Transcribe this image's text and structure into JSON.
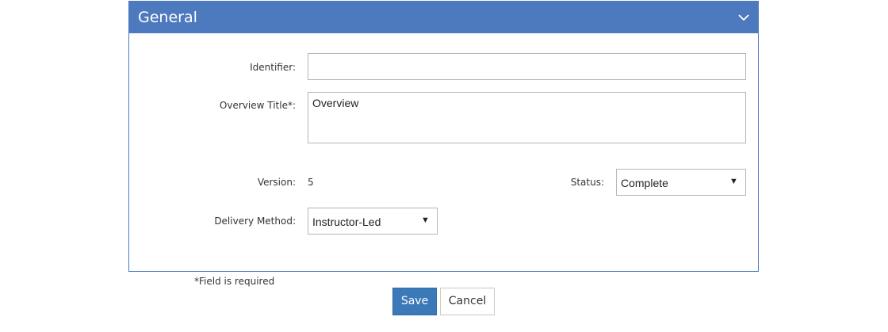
{
  "panel": {
    "title": "General",
    "collapse_icon": "chevron-down-icon",
    "header_color": "#4d7abe"
  },
  "form": {
    "identifier": {
      "label": "Identifier:",
      "value": ""
    },
    "overview_title": {
      "label": "Overview Title*:",
      "value": "Overview"
    },
    "version": {
      "label": "Version:",
      "value": "5"
    },
    "status": {
      "label": "Status:",
      "selected": "Complete"
    },
    "delivery_method": {
      "label": "Delivery Method:",
      "selected": "Instructor-Led"
    },
    "dropdown_arrow": "▼"
  },
  "footer": {
    "required_note": "*Field is required",
    "save_label": "Save",
    "cancel_label": "Cancel",
    "save_color": "#3b79b8"
  }
}
